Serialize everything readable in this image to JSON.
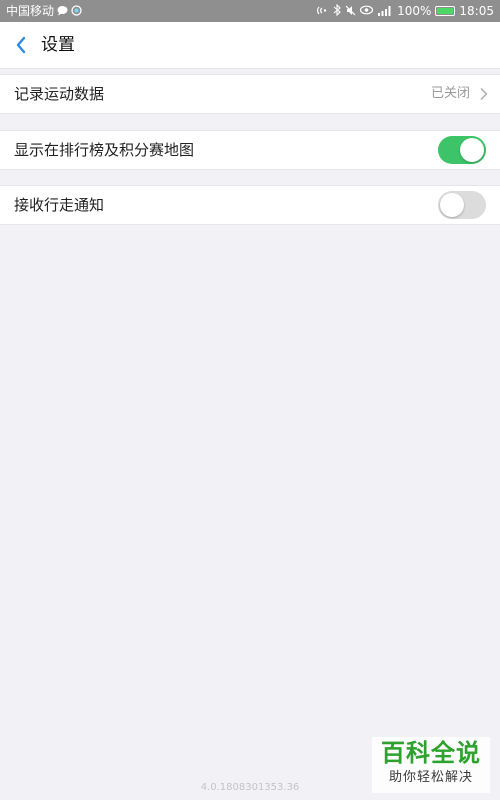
{
  "status_bar": {
    "carrier": "中国移动",
    "battery_percent": "100%",
    "time": "18:05",
    "left_icons": [
      "chat-icon",
      "app-notification-icon"
    ],
    "right_icons": [
      "nfc-icon",
      "bluetooth-icon",
      "mute-icon",
      "eye-comfort-icon",
      "signal-icon",
      "battery-icon"
    ],
    "battery_color": "#4bd864"
  },
  "header": {
    "title": "设置",
    "back_icon": "chevron-left-icon",
    "accent_color": "#2a8ce0"
  },
  "settings": [
    {
      "label": "记录运动数据",
      "value": "已关闭",
      "type": "link"
    },
    {
      "label": "显示在排行榜及积分赛地图",
      "type": "toggle",
      "enabled": true
    },
    {
      "label": "接收行走通知",
      "type": "toggle",
      "enabled": false
    }
  ],
  "toggle_on_color": "#3dc468",
  "version": "4.0.1808301353.36",
  "watermark": {
    "main": "百科全说",
    "sub": "助你轻松解决",
    "color": "#2ea12e"
  }
}
